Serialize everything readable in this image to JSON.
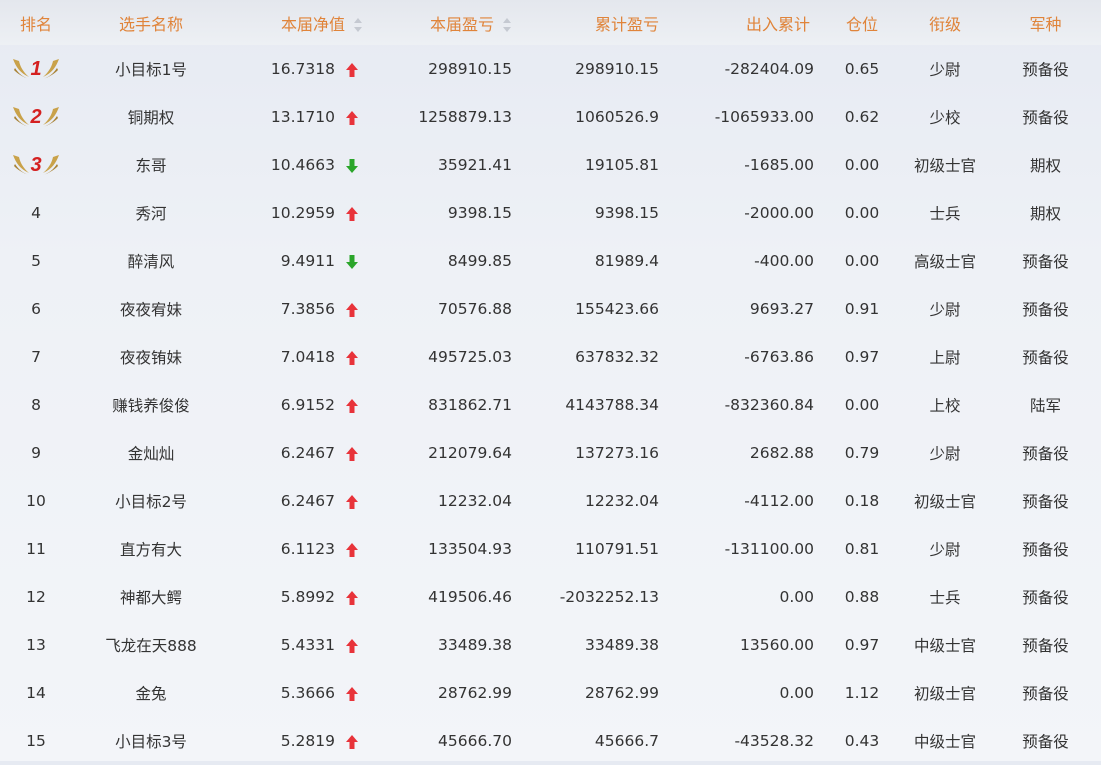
{
  "headers": {
    "rank": "排名",
    "name": "选手名称",
    "nav": "本届净值",
    "pnl": "本届盈亏",
    "cum_pnl": "累计盈亏",
    "flow": "出入累计",
    "position": "仓位",
    "title": "衔级",
    "branch": "军种"
  },
  "colors": {
    "header_text": "#e0843a",
    "up": "#e8333a",
    "down": "#2aa52a",
    "medal_gold": "#c9a24a",
    "medal_num": "#d42020"
  },
  "rows": [
    {
      "rank": "1",
      "medal": true,
      "name": "小目标1号",
      "nav": "16.7318",
      "trend": "up",
      "pnl": "298910.15",
      "cum_pnl": "298910.15",
      "flow": "-282404.09",
      "position": "0.65",
      "title": "少尉",
      "branch": "预备役"
    },
    {
      "rank": "2",
      "medal": true,
      "name": "铜期权",
      "nav": "13.1710",
      "trend": "up",
      "pnl": "1258879.13",
      "cum_pnl": "1060526.9",
      "flow": "-1065933.00",
      "position": "0.62",
      "title": "少校",
      "branch": "预备役"
    },
    {
      "rank": "3",
      "medal": true,
      "name": "东哥",
      "nav": "10.4663",
      "trend": "down",
      "pnl": "35921.41",
      "cum_pnl": "19105.81",
      "flow": "-1685.00",
      "position": "0.00",
      "title": "初级士官",
      "branch": "期权"
    },
    {
      "rank": "4",
      "medal": false,
      "name": "秀河",
      "nav": "10.2959",
      "trend": "up",
      "pnl": "9398.15",
      "cum_pnl": "9398.15",
      "flow": "-2000.00",
      "position": "0.00",
      "title": "士兵",
      "branch": "期权"
    },
    {
      "rank": "5",
      "medal": false,
      "name": "醉清风",
      "nav": "9.4911",
      "trend": "down",
      "pnl": "8499.85",
      "cum_pnl": "81989.4",
      "flow": "-400.00",
      "position": "0.00",
      "title": "高级士官",
      "branch": "预备役"
    },
    {
      "rank": "6",
      "medal": false,
      "name": "夜夜宥妹",
      "nav": "7.3856",
      "trend": "up",
      "pnl": "70576.88",
      "cum_pnl": "155423.66",
      "flow": "9693.27",
      "position": "0.91",
      "title": "少尉",
      "branch": "预备役"
    },
    {
      "rank": "7",
      "medal": false,
      "name": "夜夜铕妹",
      "nav": "7.0418",
      "trend": "up",
      "pnl": "495725.03",
      "cum_pnl": "637832.32",
      "flow": "-6763.86",
      "position": "0.97",
      "title": "上尉",
      "branch": "预备役"
    },
    {
      "rank": "8",
      "medal": false,
      "name": "赚钱养俊俊",
      "nav": "6.9152",
      "trend": "up",
      "pnl": "831862.71",
      "cum_pnl": "4143788.34",
      "flow": "-832360.84",
      "position": "0.00",
      "title": "上校",
      "branch": "陆军"
    },
    {
      "rank": "9",
      "medal": false,
      "name": "金灿灿",
      "nav": "6.2467",
      "trend": "up",
      "pnl": "212079.64",
      "cum_pnl": "137273.16",
      "flow": "2682.88",
      "position": "0.79",
      "title": "少尉",
      "branch": "预备役"
    },
    {
      "rank": "10",
      "medal": false,
      "name": "小目标2号",
      "nav": "6.2467",
      "trend": "up",
      "pnl": "12232.04",
      "cum_pnl": "12232.04",
      "flow": "-4112.00",
      "position": "0.18",
      "title": "初级士官",
      "branch": "预备役"
    },
    {
      "rank": "11",
      "medal": false,
      "name": "直方有大",
      "nav": "6.1123",
      "trend": "up",
      "pnl": "133504.93",
      "cum_pnl": "110791.51",
      "flow": "-131100.00",
      "position": "0.81",
      "title": "少尉",
      "branch": "预备役"
    },
    {
      "rank": "12",
      "medal": false,
      "name": "神都大鳄",
      "nav": "5.8992",
      "trend": "up",
      "pnl": "419506.46",
      "cum_pnl": "-2032252.13",
      "flow": "0.00",
      "position": "0.88",
      "title": "士兵",
      "branch": "预备役"
    },
    {
      "rank": "13",
      "medal": false,
      "name": "飞龙在天888",
      "nav": "5.4331",
      "trend": "up",
      "pnl": "33489.38",
      "cum_pnl": "33489.38",
      "flow": "13560.00",
      "position": "0.97",
      "title": "中级士官",
      "branch": "预备役"
    },
    {
      "rank": "14",
      "medal": false,
      "name": "金兔",
      "nav": "5.3666",
      "trend": "up",
      "pnl": "28762.99",
      "cum_pnl": "28762.99",
      "flow": "0.00",
      "position": "1.12",
      "title": "初级士官",
      "branch": "预备役"
    },
    {
      "rank": "15",
      "medal": false,
      "name": "小目标3号",
      "nav": "5.2819",
      "trend": "up",
      "pnl": "45666.70",
      "cum_pnl": "45666.7",
      "flow": "-43528.32",
      "position": "0.43",
      "title": "中级士官",
      "branch": "预备役"
    }
  ]
}
